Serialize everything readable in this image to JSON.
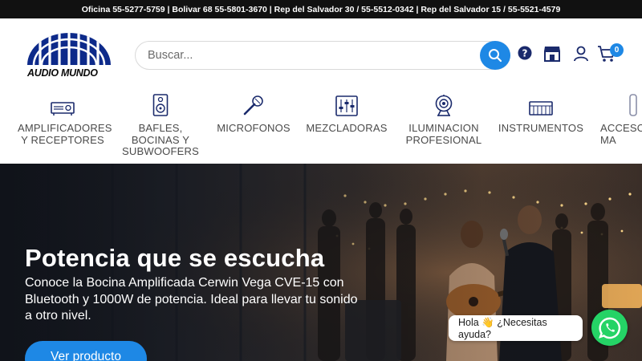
{
  "topbar": {
    "text": "Oficina 55-5277-5759 | Bolivar 68 55-5801-3670 | Rep del Salvador 30 / 55-5512-0342 | Rep del Salvador 15 / 55-5521-4579"
  },
  "brand": {
    "name": "AUDIO MUNDO",
    "color": "#0d2a8a"
  },
  "search": {
    "placeholder": "Buscar..."
  },
  "header_icons": [
    "help-icon",
    "store-icon",
    "account-icon",
    "cart-icon"
  ],
  "cart": {
    "count": "0"
  },
  "nav": {
    "items": [
      {
        "label": "AMPLIFICADORES\nY RECEPTORES",
        "icon": "amplifier-icon"
      },
      {
        "label": "BAFLES,\nBOCINAS Y\nSUBWOOFERS",
        "icon": "speaker-icon"
      },
      {
        "label": "MICROFONOS",
        "icon": "microphone-icon"
      },
      {
        "label": "MEZCLADORAS",
        "icon": "mixer-icon"
      },
      {
        "label": "ILUMINACION\nPROFESIONAL",
        "icon": "stage-light-icon"
      },
      {
        "label": "INSTRUMENTOS",
        "icon": "keyboard-icon"
      },
      {
        "label": "ACCESO\nMA",
        "icon": "accessory-icon"
      }
    ]
  },
  "hero": {
    "title": "Potencia que se escucha",
    "subtitle": "Conoce la Bocina Amplificada Cerwin Vega CVE-15 con Bluetooth y 1000W de potencia. Ideal para llevar tu sonido a otro nivel.",
    "cta": "Ver producto"
  },
  "chat": {
    "bubble": "Hola 👋 ¿Necesitas ayuda?"
  },
  "colors": {
    "accent": "#1e88e5",
    "topbar": "#111111",
    "whatsapp": "#25d366"
  }
}
